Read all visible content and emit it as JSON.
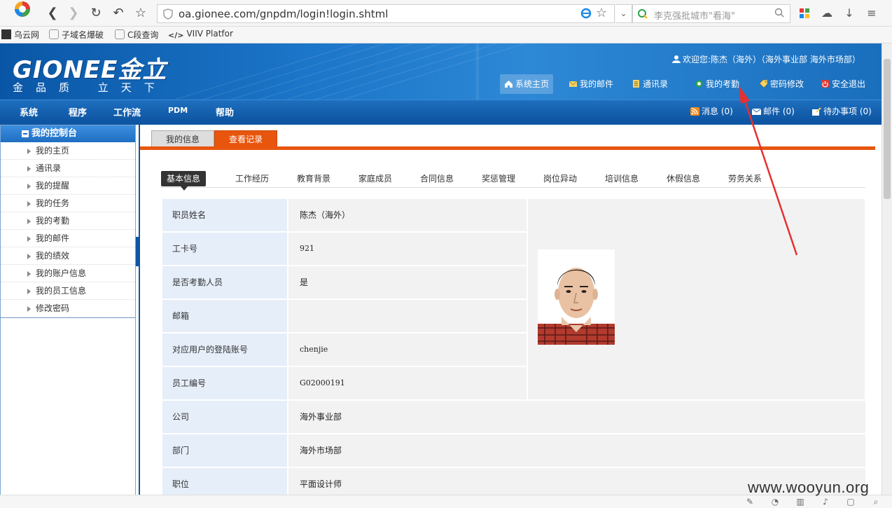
{
  "browser": {
    "url": "oa.gionee.com/gnpdm/login!login.shtml",
    "search_placeholder": "李克强批城市\"看海\"",
    "bookmarks": [
      "乌云网",
      "子域名爆破",
      "C段查询",
      "VIIV Platfor"
    ]
  },
  "site": {
    "logo": "GIONEE金立",
    "slogan": "金品质 立天下",
    "welcome": "欢迎您:陈杰（海外）（海外事业部 海外市场部）",
    "top_links": [
      "系统主页",
      "我的邮件",
      "通讯录",
      "我的考勤",
      "密码修改",
      "安全退出"
    ],
    "menu": [
      "系统",
      "程序",
      "工作流",
      "PDM",
      "帮助"
    ],
    "messages": [
      "消息 (0)",
      "邮件 (0)",
      "待办事项 (0)"
    ]
  },
  "sidebar": {
    "title": "我的控制台",
    "items": [
      "我的主页",
      "通讯录",
      "我的提醒",
      "我的任务",
      "我的考勤",
      "我的邮件",
      "我的绩效",
      "我的账户信息",
      "我的员工信息",
      "修改密码"
    ]
  },
  "main": {
    "tabs": [
      "我的信息",
      "查看记录"
    ],
    "subtabs": [
      "基本信息",
      "工作经历",
      "教育背景",
      "家庭成员",
      "合同信息",
      "奖惩管理",
      "岗位异动",
      "培训信息",
      "休假信息",
      "劳务关系"
    ],
    "fields": [
      {
        "label": "职员姓名",
        "value": "陈杰（海外）"
      },
      {
        "label": "工卡号",
        "value": "921"
      },
      {
        "label": "是否考勤人员",
        "value": "是"
      },
      {
        "label": "邮箱",
        "value": ""
      },
      {
        "label": "对应用户的登陆账号",
        "value": "chenjie"
      },
      {
        "label": "员工编号",
        "value": "G02000191"
      },
      {
        "label": "公司",
        "value": "海外事业部"
      },
      {
        "label": "部门",
        "value": "海外市场部"
      },
      {
        "label": "职位",
        "value": "平面设计师"
      }
    ]
  },
  "watermark": "www.wooyun.org",
  "colors": {
    "brand_blue": "#0e56a3",
    "accent_orange": "#e8560e",
    "annotation_red": "#e53030"
  }
}
